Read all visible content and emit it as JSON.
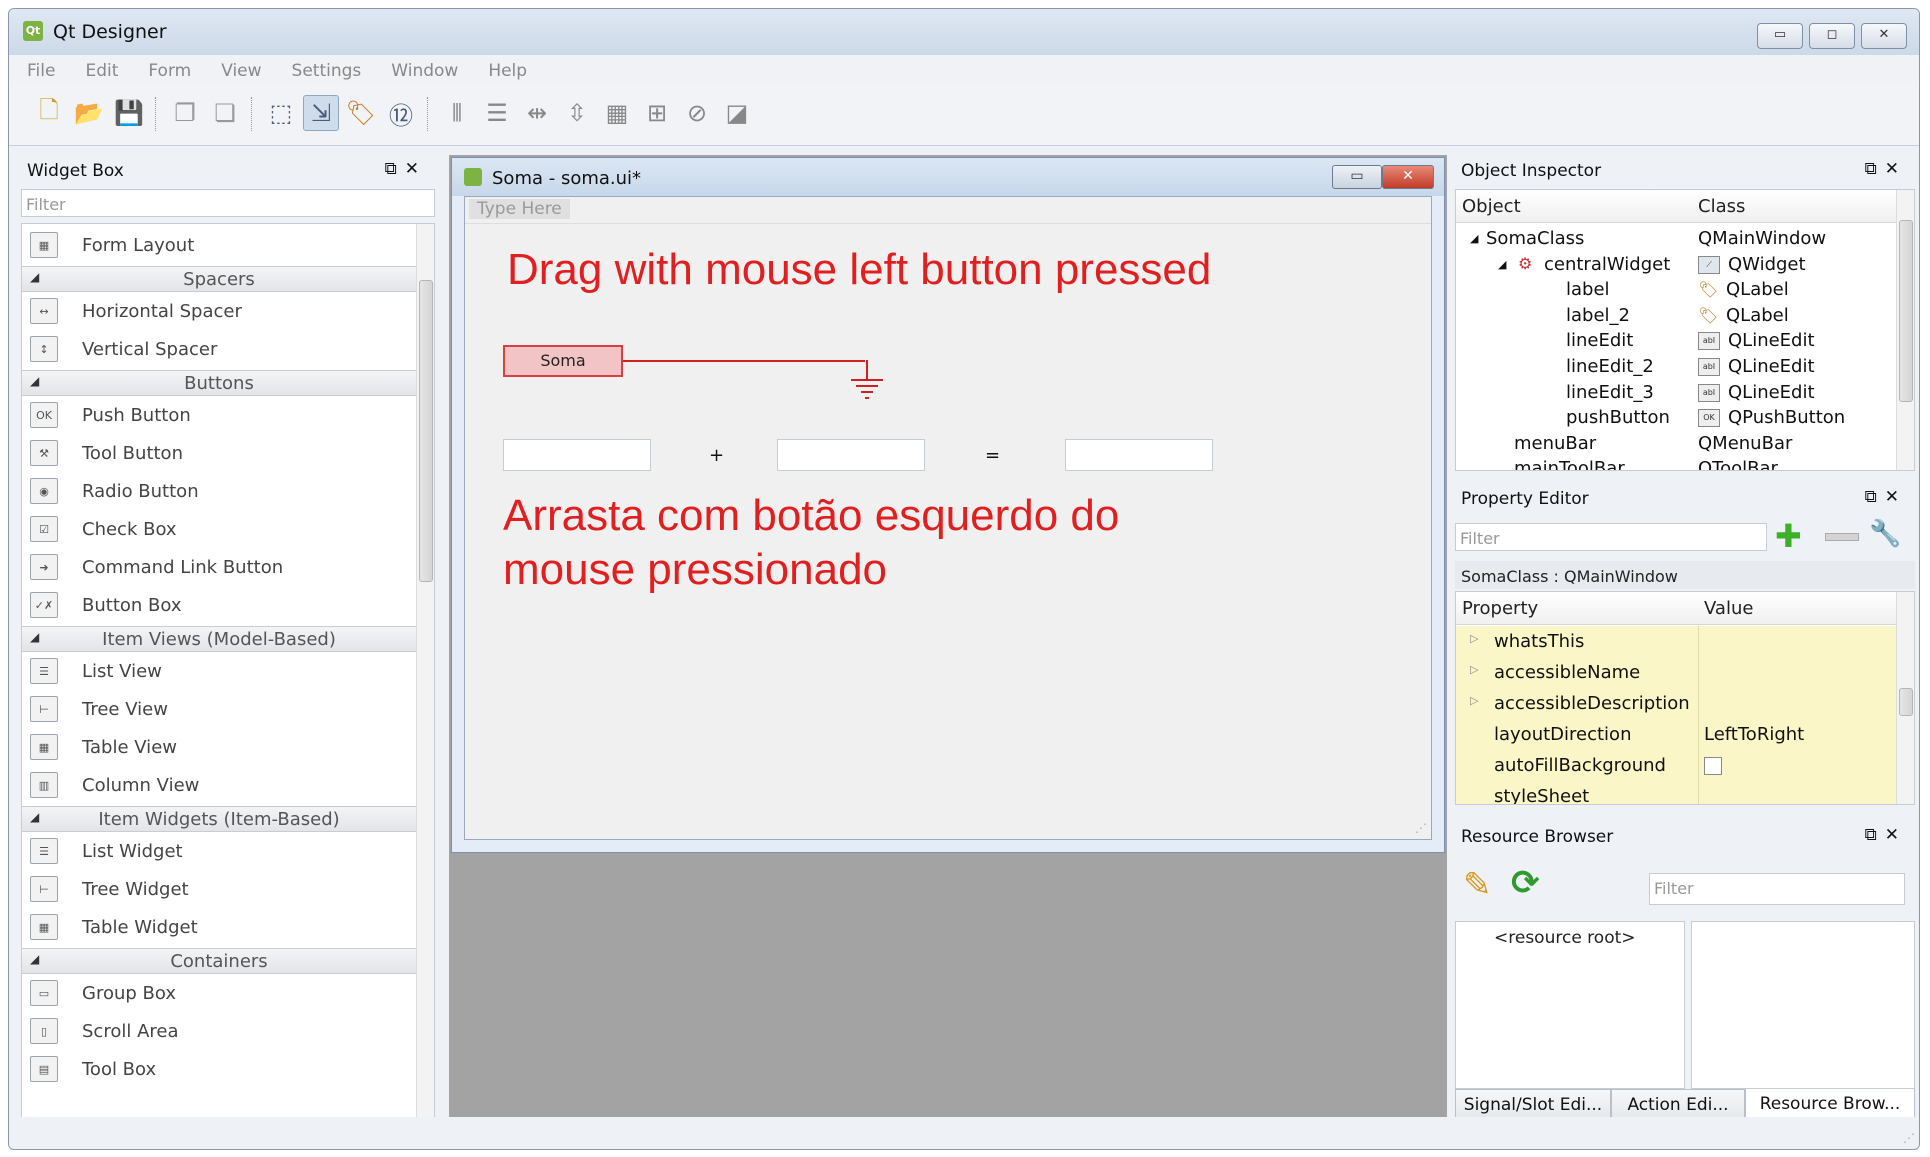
{
  "app": {
    "title": "Qt Designer",
    "icon_label": "Qt"
  },
  "menubar": [
    "File",
    "Edit",
    "Form",
    "View",
    "Settings",
    "Window",
    "Help"
  ],
  "toolbar": {
    "buttons": [
      "new-file-icon",
      "open-file-icon",
      "save-icon",
      "send-to-back-icon",
      "bring-to-front-icon",
      "edit-widgets-icon",
      "edit-signals-slots-icon",
      "edit-buddies-icon",
      "edit-tab-order-icon",
      "layout-horizontal-icon",
      "layout-vertical-icon",
      "layout-horizontal-splitter-icon",
      "layout-vertical-splitter-icon",
      "layout-grid-icon",
      "layout-form-icon",
      "break-layout-icon",
      "adjust-size-icon"
    ]
  },
  "widget_box": {
    "title": "Widget Box",
    "filter_placeholder": "Filter",
    "entries": [
      {
        "kind": "item",
        "label": "Form Layout",
        "icon": "form-layout-icon",
        "glyph": "▦"
      },
      {
        "kind": "cat",
        "label": "Spacers"
      },
      {
        "kind": "item",
        "label": "Horizontal Spacer",
        "icon": "horizontal-spacer-icon",
        "glyph": "↔"
      },
      {
        "kind": "item",
        "label": "Vertical Spacer",
        "icon": "vertical-spacer-icon",
        "glyph": "↕"
      },
      {
        "kind": "cat",
        "label": "Buttons"
      },
      {
        "kind": "item",
        "label": "Push Button",
        "icon": "push-button-icon",
        "glyph": "OK"
      },
      {
        "kind": "item",
        "label": "Tool Button",
        "icon": "tool-button-icon",
        "glyph": "⚒"
      },
      {
        "kind": "item",
        "label": "Radio Button",
        "icon": "radio-button-icon",
        "glyph": "◉"
      },
      {
        "kind": "item",
        "label": "Check Box",
        "icon": "check-box-icon",
        "glyph": "☑"
      },
      {
        "kind": "item",
        "label": "Command Link Button",
        "icon": "command-link-icon",
        "glyph": "➜"
      },
      {
        "kind": "item",
        "label": "Button Box",
        "icon": "button-box-icon",
        "glyph": "✓✗"
      },
      {
        "kind": "cat",
        "label": "Item Views (Model-Based)"
      },
      {
        "kind": "item",
        "label": "List View",
        "icon": "list-view-icon",
        "glyph": "☰"
      },
      {
        "kind": "item",
        "label": "Tree View",
        "icon": "tree-view-icon",
        "glyph": "⊢"
      },
      {
        "kind": "item",
        "label": "Table View",
        "icon": "table-view-icon",
        "glyph": "▦"
      },
      {
        "kind": "item",
        "label": "Column View",
        "icon": "column-view-icon",
        "glyph": "▥"
      },
      {
        "kind": "cat",
        "label": "Item Widgets (Item-Based)"
      },
      {
        "kind": "item",
        "label": "List Widget",
        "icon": "list-widget-icon",
        "glyph": "☰"
      },
      {
        "kind": "item",
        "label": "Tree Widget",
        "icon": "tree-widget-icon",
        "glyph": "⊢"
      },
      {
        "kind": "item",
        "label": "Table Widget",
        "icon": "table-widget-icon",
        "glyph": "▦"
      },
      {
        "kind": "cat",
        "label": "Containers"
      },
      {
        "kind": "item",
        "label": "Group Box",
        "icon": "group-box-icon",
        "glyph": "▭"
      },
      {
        "kind": "item",
        "label": "Scroll Area",
        "icon": "scroll-area-icon",
        "glyph": "▯"
      },
      {
        "kind": "item",
        "label": "Tool Box",
        "icon": "tool-box-icon",
        "glyph": "▤"
      }
    ]
  },
  "form_window": {
    "title": "Soma - soma.ui*",
    "menu_placeholder": "Type Here",
    "caption_en": "Drag with mouse left button pressed",
    "caption_pt_line1": "Arrasta com botão esquerdo do",
    "caption_pt_line2": "mouse pressionado",
    "soma_button": "Soma",
    "plus": "+",
    "equals": "="
  },
  "object_inspector": {
    "title": "Object Inspector",
    "col_object": "Object",
    "col_class": "Class",
    "rows": [
      {
        "object": "SomaClass",
        "class": "QMainWindow",
        "level": 0,
        "expander": "◢",
        "icon": ""
      },
      {
        "object": "centralWidget",
        "class": "QWidget",
        "level": 1,
        "expander": "◢",
        "icon": "widget-icon"
      },
      {
        "object": "label",
        "class": "QLabel",
        "level": 2,
        "expander": "",
        "icon": "label-icon"
      },
      {
        "object": "label_2",
        "class": "QLabel",
        "level": 2,
        "expander": "",
        "icon": "label-icon"
      },
      {
        "object": "lineEdit",
        "class": "QLineEdit",
        "level": 2,
        "expander": "",
        "icon": "line-edit-icon"
      },
      {
        "object": "lineEdit_2",
        "class": "QLineEdit",
        "level": 2,
        "expander": "",
        "icon": "line-edit-icon"
      },
      {
        "object": "lineEdit_3",
        "class": "QLineEdit",
        "level": 2,
        "expander": "",
        "icon": "line-edit-icon"
      },
      {
        "object": "pushButton",
        "class": "QPushButton",
        "level": 2,
        "expander": "",
        "icon": "push-button-icon"
      },
      {
        "object": "menuBar",
        "class": "QMenuBar",
        "level": 1,
        "expander": "",
        "icon": ""
      },
      {
        "object": "mainToolBar",
        "class": "QToolBar",
        "level": 1,
        "expander": "",
        "icon": ""
      }
    ]
  },
  "property_editor": {
    "title": "Property Editor",
    "filter_placeholder": "Filter",
    "context": "SomaClass : QMainWindow",
    "col_property": "Property",
    "col_value": "Value",
    "rows": [
      {
        "property": "whatsThis",
        "value": "",
        "expandable": true
      },
      {
        "property": "accessibleName",
        "value": "",
        "expandable": true
      },
      {
        "property": "accessibleDescription",
        "value": "",
        "expandable": true
      },
      {
        "property": "layoutDirection",
        "value": "LeftToRight",
        "expandable": false
      },
      {
        "property": "autoFillBackground",
        "value": "",
        "expandable": false,
        "checkbox": true
      },
      {
        "property": "styleSheet",
        "value": "",
        "expandable": false
      }
    ]
  },
  "resource_browser": {
    "title": "Resource Browser",
    "filter_placeholder": "Filter",
    "root": "<resource root>"
  },
  "bottom_tabs": [
    "Signal/Slot Edi...",
    "Action Edi...",
    "Resource Brow..."
  ],
  "selected_tab": "Resource Brow...",
  "colors": {
    "accent_red": "#e02020",
    "property_highlight": "#fbf6c8"
  }
}
